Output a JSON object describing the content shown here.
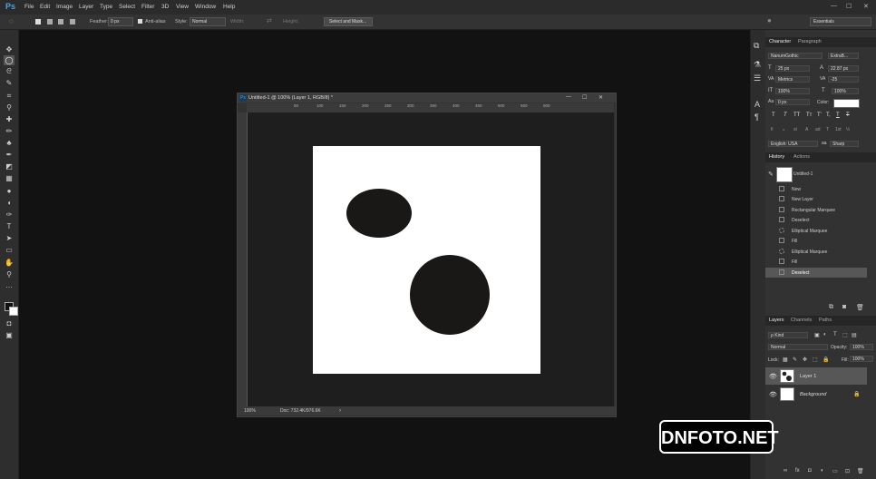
{
  "app": {
    "logo": "Ps",
    "menus": [
      "File",
      "Edit",
      "Image",
      "Layer",
      "Type",
      "Select",
      "Filter",
      "3D",
      "View",
      "Window",
      "Help"
    ],
    "window_controls": [
      "—",
      "☐",
      "✕"
    ]
  },
  "options_bar": {
    "feather_label": "Feather:",
    "feather_value": "0 px",
    "antialias_label": "Anti-alias",
    "style_label": "Style:",
    "style_value": "Normal",
    "width_label": "Width:",
    "height_label": "Height:",
    "select_mask_label": "Select and Mask...",
    "workspace": "Essentials"
  },
  "document": {
    "tab_logo": "Ps",
    "title": "Untitled-1 @ 100% (Layer 1, RGB/8) *",
    "window_controls": [
      "—",
      "☐",
      "✕"
    ],
    "ruler_ticks": [
      "50",
      "100",
      "150",
      "200",
      "250",
      "300",
      "350",
      "400",
      "450",
      "500",
      "550",
      "600"
    ],
    "zoom": "100%",
    "doc_info": "Doc: 732.4K/976.6K"
  },
  "character_panel": {
    "tabs": [
      "Character",
      "Paragraph"
    ],
    "font_family": "NanumGothic",
    "font_style": "ExtraB...",
    "font_size": "25 px",
    "leading": "22.87 px",
    "kerning": "Metrics",
    "tracking": "-25",
    "vertical_scale": "100%",
    "horizontal_scale": "100%",
    "baseline_shift": "0 px",
    "color_label": "Color:",
    "type_styles": [
      "T",
      "T",
      "TT",
      "Tт",
      "T'",
      "T,",
      "T",
      "T"
    ],
    "opentype": [
      "fi",
      "ℴ",
      "st",
      "A",
      "ad",
      "T",
      "1st",
      "½"
    ],
    "language": "English: USA",
    "antialias": "Sharp"
  },
  "history_panel": {
    "tabs": [
      "History",
      "Actions"
    ],
    "snapshot": "Untitled-1",
    "items": [
      "New",
      "New Layer",
      "Rectangular Marquee",
      "Deselect",
      "Elliptical Marquee",
      "Fill",
      "Elliptical Marquee",
      "Fill",
      "Deselect"
    ]
  },
  "layers_panel": {
    "tabs": [
      "Layers",
      "Channels",
      "Paths"
    ],
    "kind": "ρ Kind",
    "blend_mode": "Normal",
    "opacity_label": "Opacity:",
    "opacity_value": "100%",
    "lock_label": "Lock:",
    "fill_label": "Fill:",
    "fill_value": "100%",
    "layers": [
      {
        "name": "Layer 1"
      },
      {
        "name": "Background"
      }
    ],
    "footer_icons": [
      "∞",
      "fx",
      "◘",
      "◐",
      "▭",
      "⊡",
      "🗑"
    ]
  },
  "watermark": "DNFOTO.NET"
}
